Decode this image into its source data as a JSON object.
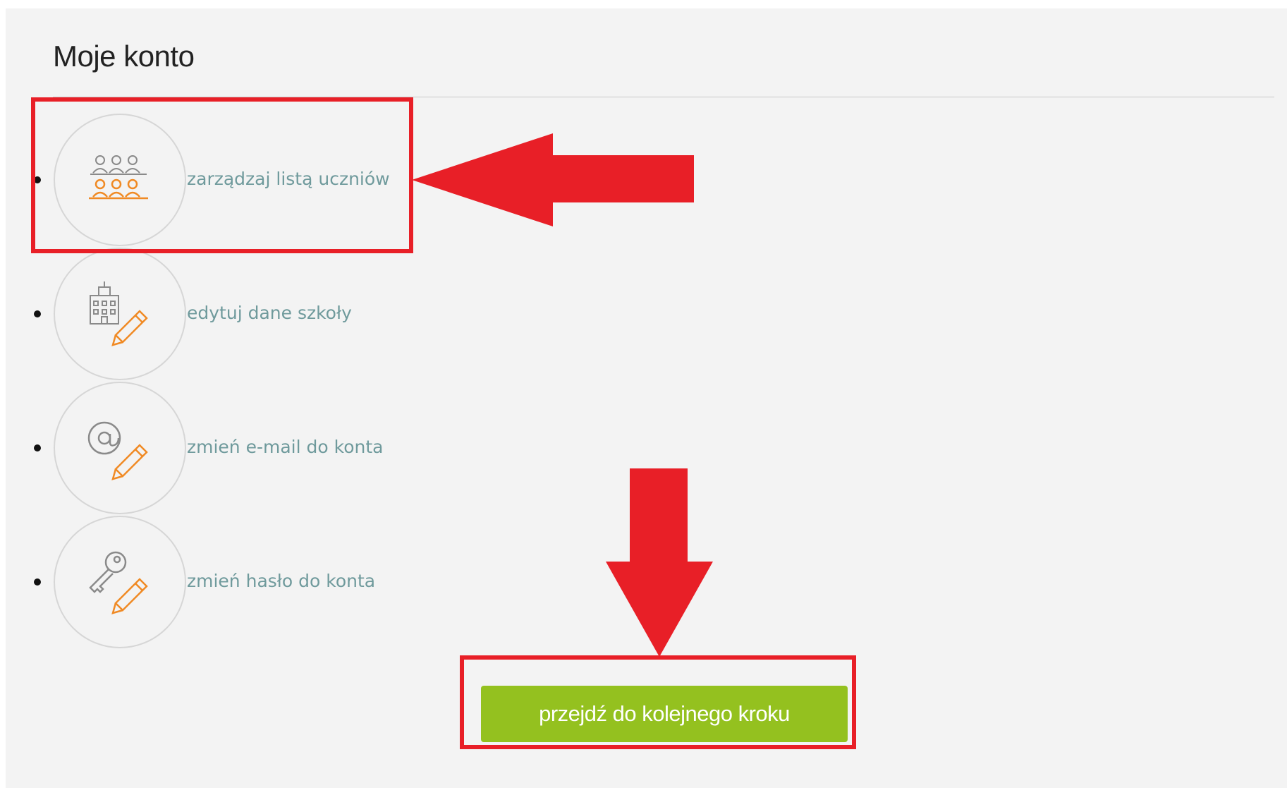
{
  "page": {
    "title": "Moje konto"
  },
  "menu": {
    "items": [
      {
        "label": "zarządzaj listą uczniów",
        "icon": "students-group-icon"
      },
      {
        "label": "edytuj dane szkoły",
        "icon": "school-edit-icon"
      },
      {
        "label": "zmień e-mail do konta",
        "icon": "email-edit-icon"
      },
      {
        "label": "zmień hasło do konta",
        "icon": "key-edit-icon"
      }
    ]
  },
  "actions": {
    "next_label": "przejdź do kolejnego kroku"
  },
  "colors": {
    "background": "#f3f3f3",
    "link": "#6f9a9c",
    "icon_accent": "#f08a24",
    "icon_gray": "#8a8a8a",
    "button": "#94c11f",
    "annotation_red": "#e81f27"
  }
}
